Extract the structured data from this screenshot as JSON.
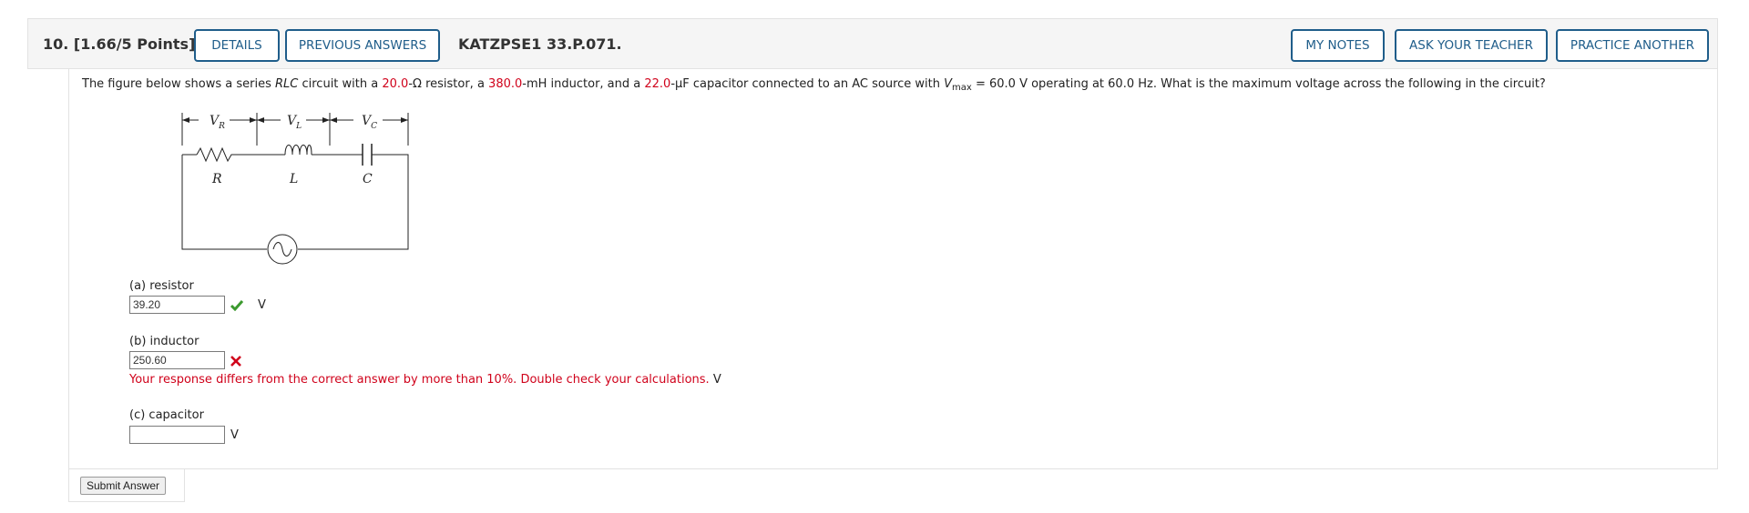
{
  "header": {
    "question_number": "10.",
    "points": "[1.66/5 Points]",
    "details_label": "DETAILS",
    "previous_answers_label": "PREVIOUS ANSWERS",
    "question_id": "KATZPSE1 33.P.071.",
    "my_notes_label": "MY NOTES",
    "ask_teacher_label": "ASK YOUR TEACHER",
    "practice_another_label": "PRACTICE ANOTHER"
  },
  "prompt": {
    "t1": "The figure below shows a series ",
    "rlc": "RLC",
    "t2": " circuit with a ",
    "resistance": "20.0",
    "t3": "-Ω resistor, a ",
    "inductance": "380.0",
    "t4": "-mH inductor, and a ",
    "capacitance": "22.0",
    "t5": "-μF capacitor connected to an AC source with ",
    "vmax_symbol": "V",
    "vmax_sub": "max",
    "t6": " = 60.0 V  operating at 60.0 Hz. What is the maximum voltage across the following in the circuit?"
  },
  "circuit": {
    "vr": "V",
    "vr_sub": "R",
    "vl": "V",
    "vl_sub": "L",
    "vc": "V",
    "vc_sub": "C",
    "r_label": "R",
    "l_label": "L",
    "c_label": "C"
  },
  "parts": [
    {
      "label": "(a) resistor",
      "value": "39.20",
      "unit": "V",
      "status": "correct"
    },
    {
      "label": "(b) inductor",
      "value": "250.60",
      "unit": "V",
      "status": "incorrect",
      "feedback": "Your response differs from the correct answer by more than 10%. Double check your calculations."
    },
    {
      "label": "(c) capacitor",
      "value": "",
      "unit": "V",
      "status": "unanswered"
    }
  ],
  "submit_label": "Submit Answer",
  "colors": {
    "accent": "#1f5d8a",
    "error": "#d0021b",
    "correct": "#3c9a2f"
  }
}
